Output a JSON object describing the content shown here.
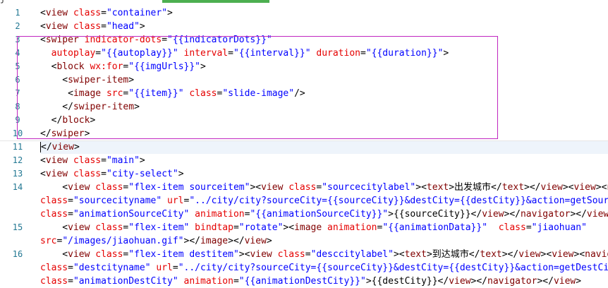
{
  "tab_strip_partial_text": "j  ",
  "lines": [
    {
      "n": "1",
      "tokens": [
        {
          "t": "tx",
          "v": "<"
        },
        {
          "t": "tg",
          "v": "view"
        },
        {
          "t": "tx",
          "v": " "
        },
        {
          "t": "at",
          "v": "class"
        },
        {
          "t": "tx",
          "v": "="
        },
        {
          "t": "vl",
          "v": "\"container\""
        },
        {
          "t": "tx",
          "v": ">"
        }
      ]
    },
    {
      "n": "2",
      "tokens": [
        {
          "t": "tx",
          "v": "<"
        },
        {
          "t": "tg",
          "v": "view"
        },
        {
          "t": "tx",
          "v": " "
        },
        {
          "t": "at",
          "v": "class"
        },
        {
          "t": "tx",
          "v": "="
        },
        {
          "t": "vl",
          "v": "\"head\""
        },
        {
          "t": "tx",
          "v": ">"
        }
      ]
    },
    {
      "n": "3",
      "tokens": [
        {
          "t": "tx",
          "v": "<"
        },
        {
          "t": "tg",
          "v": "swiper"
        },
        {
          "t": "tx",
          "v": " "
        },
        {
          "t": "at",
          "v": "indicator-dots"
        },
        {
          "t": "tx",
          "v": "="
        },
        {
          "t": "vl",
          "v": "\"{{indicatorDots}}\""
        }
      ]
    },
    {
      "n": "4",
      "tokens": [
        {
          "t": "tx",
          "v": "  "
        },
        {
          "t": "at",
          "v": "autoplay"
        },
        {
          "t": "tx",
          "v": "="
        },
        {
          "t": "vl",
          "v": "\"{{autoplay}}\""
        },
        {
          "t": "tx",
          "v": " "
        },
        {
          "t": "at",
          "v": "interval"
        },
        {
          "t": "tx",
          "v": "="
        },
        {
          "t": "vl",
          "v": "\"{{interval}}\""
        },
        {
          "t": "tx",
          "v": " "
        },
        {
          "t": "at",
          "v": "duration"
        },
        {
          "t": "tx",
          "v": "="
        },
        {
          "t": "vl",
          "v": "\"{{duration}}\""
        },
        {
          "t": "tx",
          "v": ">"
        }
      ]
    },
    {
      "n": "5",
      "tokens": [
        {
          "t": "tx",
          "v": "  <"
        },
        {
          "t": "tg",
          "v": "block"
        },
        {
          "t": "tx",
          "v": " "
        },
        {
          "t": "at",
          "v": "wx:for"
        },
        {
          "t": "tx",
          "v": "="
        },
        {
          "t": "vl",
          "v": "\"{{imgUrls}}\""
        },
        {
          "t": "tx",
          "v": ">"
        }
      ]
    },
    {
      "n": "6",
      "tokens": [
        {
          "t": "tx",
          "v": "    <"
        },
        {
          "t": "tg",
          "v": "swiper-item"
        },
        {
          "t": "tx",
          "v": ">"
        }
      ]
    },
    {
      "n": "7",
      "tokens": [
        {
          "t": "tx",
          "v": "     <"
        },
        {
          "t": "tg",
          "v": "image"
        },
        {
          "t": "tx",
          "v": " "
        },
        {
          "t": "at",
          "v": "src"
        },
        {
          "t": "tx",
          "v": "="
        },
        {
          "t": "vl",
          "v": "\"{{item}}\""
        },
        {
          "t": "tx",
          "v": " "
        },
        {
          "t": "at",
          "v": "class"
        },
        {
          "t": "tx",
          "v": "="
        },
        {
          "t": "vl",
          "v": "\"slide-image\""
        },
        {
          "t": "tx",
          "v": "/>"
        }
      ]
    },
    {
      "n": "8",
      "tokens": [
        {
          "t": "tx",
          "v": "    </"
        },
        {
          "t": "tg",
          "v": "swiper-item"
        },
        {
          "t": "tx",
          "v": ">"
        }
      ]
    },
    {
      "n": "9",
      "tokens": [
        {
          "t": "tx",
          "v": "  </"
        },
        {
          "t": "tg",
          "v": "block"
        },
        {
          "t": "tx",
          "v": ">"
        }
      ]
    },
    {
      "n": "10",
      "tokens": [
        {
          "t": "tx",
          "v": "</"
        },
        {
          "t": "tg",
          "v": "swiper"
        },
        {
          "t": "tx",
          "v": ">"
        }
      ]
    },
    {
      "n": "11",
      "tokens": [
        {
          "t": "tx",
          "v": "</"
        },
        {
          "t": "tg",
          "v": "view"
        },
        {
          "t": "tx",
          "v": ">"
        }
      ]
    },
    {
      "n": "12",
      "tokens": [
        {
          "t": "tx",
          "v": "<"
        },
        {
          "t": "tg",
          "v": "view"
        },
        {
          "t": "tx",
          "v": " "
        },
        {
          "t": "at",
          "v": "class"
        },
        {
          "t": "tx",
          "v": "="
        },
        {
          "t": "vl",
          "v": "\"main\""
        },
        {
          "t": "tx",
          "v": ">"
        }
      ]
    },
    {
      "n": "13",
      "tokens": [
        {
          "t": "tx",
          "v": "<"
        },
        {
          "t": "tg",
          "v": "view"
        },
        {
          "t": "tx",
          "v": " "
        },
        {
          "t": "at",
          "v": "class"
        },
        {
          "t": "tx",
          "v": "="
        },
        {
          "t": "vl",
          "v": "\"city-select\""
        },
        {
          "t": "tx",
          "v": ">"
        }
      ]
    },
    {
      "n": "14",
      "tokens": [
        {
          "t": "tx",
          "v": "    <"
        },
        {
          "t": "tg",
          "v": "view"
        },
        {
          "t": "tx",
          "v": " "
        },
        {
          "t": "at",
          "v": "class"
        },
        {
          "t": "tx",
          "v": "="
        },
        {
          "t": "vl",
          "v": "\"flex-item sourceitem\""
        },
        {
          "t": "tx",
          "v": "><"
        },
        {
          "t": "tg",
          "v": "view"
        },
        {
          "t": "tx",
          "v": " "
        },
        {
          "t": "at",
          "v": "class"
        },
        {
          "t": "tx",
          "v": "="
        },
        {
          "t": "vl",
          "v": "\"sourcecitylabel\""
        },
        {
          "t": "tx",
          "v": "><"
        },
        {
          "t": "tg",
          "v": "text"
        },
        {
          "t": "tx",
          "v": ">出发城市</"
        },
        {
          "t": "tg",
          "v": "text"
        },
        {
          "t": "tx",
          "v": "></"
        },
        {
          "t": "tg",
          "v": "view"
        },
        {
          "t": "tx",
          "v": "><"
        },
        {
          "t": "tg",
          "v": "view"
        },
        {
          "t": "tx",
          "v": "><"
        },
        {
          "t": "tg",
          "v": "na"
        }
      ]
    },
    {
      "n": "",
      "tokens": [
        {
          "t": "at",
          "v": "class"
        },
        {
          "t": "tx",
          "v": "="
        },
        {
          "t": "vl",
          "v": "\"sourcecityname\""
        },
        {
          "t": "tx",
          "v": " "
        },
        {
          "t": "at",
          "v": "url"
        },
        {
          "t": "tx",
          "v": "="
        },
        {
          "t": "vl",
          "v": "\"../city/city?sourceCity={{sourceCity}}&destCity={{destCity}}&action=getSource"
        }
      ]
    },
    {
      "n": "",
      "tokens": [
        {
          "t": "at",
          "v": "class"
        },
        {
          "t": "tx",
          "v": "="
        },
        {
          "t": "vl",
          "v": "\"animationSourceCity\""
        },
        {
          "t": "tx",
          "v": " "
        },
        {
          "t": "at",
          "v": "animation"
        },
        {
          "t": "tx",
          "v": "="
        },
        {
          "t": "vl",
          "v": "\"{{animationSourceCity}}\""
        },
        {
          "t": "tx",
          "v": ">{{sourceCity}}</"
        },
        {
          "t": "tg",
          "v": "view"
        },
        {
          "t": "tx",
          "v": "></"
        },
        {
          "t": "tg",
          "v": "navigator"
        },
        {
          "t": "tx",
          "v": "></"
        },
        {
          "t": "tg",
          "v": "view"
        },
        {
          "t": "tx",
          "v": ">"
        }
      ]
    },
    {
      "n": "15",
      "tokens": [
        {
          "t": "tx",
          "v": "    <"
        },
        {
          "t": "tg",
          "v": "view"
        },
        {
          "t": "tx",
          "v": " "
        },
        {
          "t": "at",
          "v": "class"
        },
        {
          "t": "tx",
          "v": "="
        },
        {
          "t": "vl",
          "v": "\"flex-item\""
        },
        {
          "t": "tx",
          "v": " "
        },
        {
          "t": "at",
          "v": "bindtap"
        },
        {
          "t": "tx",
          "v": "="
        },
        {
          "t": "vl",
          "v": "\"rotate\""
        },
        {
          "t": "tx",
          "v": "><"
        },
        {
          "t": "tg",
          "v": "image"
        },
        {
          "t": "tx",
          "v": " "
        },
        {
          "t": "at",
          "v": "animation"
        },
        {
          "t": "tx",
          "v": "="
        },
        {
          "t": "vl",
          "v": "\"{{animationData}}\""
        },
        {
          "t": "tx",
          "v": "  "
        },
        {
          "t": "at",
          "v": "class"
        },
        {
          "t": "tx",
          "v": "="
        },
        {
          "t": "vl",
          "v": "\"jiaohuan\""
        }
      ]
    },
    {
      "n": "",
      "tokens": [
        {
          "t": "at",
          "v": "src"
        },
        {
          "t": "tx",
          "v": "="
        },
        {
          "t": "vl",
          "v": "\"/images/jiaohuan.gif\""
        },
        {
          "t": "tx",
          "v": "></"
        },
        {
          "t": "tg",
          "v": "image"
        },
        {
          "t": "tx",
          "v": "></"
        },
        {
          "t": "tg",
          "v": "view"
        },
        {
          "t": "tx",
          "v": ">"
        }
      ]
    },
    {
      "n": "16",
      "tokens": [
        {
          "t": "tx",
          "v": "    <"
        },
        {
          "t": "tg",
          "v": "view"
        },
        {
          "t": "tx",
          "v": " "
        },
        {
          "t": "at",
          "v": "class"
        },
        {
          "t": "tx",
          "v": "="
        },
        {
          "t": "vl",
          "v": "\"flex-item destitem\""
        },
        {
          "t": "tx",
          "v": "><"
        },
        {
          "t": "tg",
          "v": "view"
        },
        {
          "t": "tx",
          "v": " "
        },
        {
          "t": "at",
          "v": "class"
        },
        {
          "t": "tx",
          "v": "="
        },
        {
          "t": "vl",
          "v": "\"desccitylabel\""
        },
        {
          "t": "tx",
          "v": "><"
        },
        {
          "t": "tg",
          "v": "text"
        },
        {
          "t": "tx",
          "v": ">到达城市</"
        },
        {
          "t": "tg",
          "v": "text"
        },
        {
          "t": "tx",
          "v": "></"
        },
        {
          "t": "tg",
          "v": "view"
        },
        {
          "t": "tx",
          "v": "><"
        },
        {
          "t": "tg",
          "v": "view"
        },
        {
          "t": "tx",
          "v": "><"
        },
        {
          "t": "tg",
          "v": "navig"
        }
      ]
    },
    {
      "n": "",
      "tokens": [
        {
          "t": "at",
          "v": "class"
        },
        {
          "t": "tx",
          "v": "="
        },
        {
          "t": "vl",
          "v": "\"destcityname\""
        },
        {
          "t": "tx",
          "v": " "
        },
        {
          "t": "at",
          "v": "url"
        },
        {
          "t": "tx",
          "v": "="
        },
        {
          "t": "vl",
          "v": "\"../city/city?sourceCity={{sourceCity}}&destCity={{destCity}}&action=getDestCity"
        }
      ]
    },
    {
      "n": "",
      "tokens": [
        {
          "t": "at",
          "v": "class"
        },
        {
          "t": "tx",
          "v": "="
        },
        {
          "t": "vl",
          "v": "\"animationDestCity\""
        },
        {
          "t": "tx",
          "v": " "
        },
        {
          "t": "at",
          "v": "animation"
        },
        {
          "t": "tx",
          "v": "="
        },
        {
          "t": "vl",
          "v": "\"{{animationDestCity}}\""
        },
        {
          "t": "tx",
          "v": ">{{destCity}}</"
        },
        {
          "t": "tg",
          "v": "view"
        },
        {
          "t": "tx",
          "v": "></"
        },
        {
          "t": "tg",
          "v": "navigator"
        },
        {
          "t": "tx",
          "v": "></"
        },
        {
          "t": "tg",
          "v": "view"
        },
        {
          "t": "tx",
          "v": ">"
        }
      ]
    }
  ],
  "colors": {
    "tag": "#800000",
    "attribute": "#e50000",
    "value": "#0000ff",
    "text": "#000000",
    "line_number": "#237893",
    "selection_border": "#c026c0",
    "tab_indicator": "#4caf50"
  }
}
